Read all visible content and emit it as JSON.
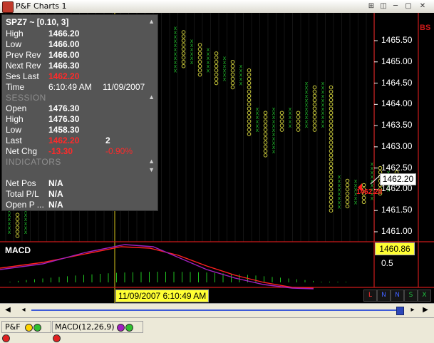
{
  "window": {
    "title": "P&F Charts 1"
  },
  "info": {
    "symbol": "SPZ7 ~ [0.10, 3]",
    "rows": [
      {
        "k": "High",
        "v": "1466.20"
      },
      {
        "k": "Low",
        "v": "1466.00"
      },
      {
        "k": "Prev Rev",
        "v": "1466.00"
      },
      {
        "k": "Next Rev",
        "v": "1466.30"
      },
      {
        "k": "Ses Last",
        "v": "1462.20"
      }
    ],
    "time_label": "Time",
    "time": "6:10:49 AM",
    "date": "11/09/2007",
    "session_header": "SESSION",
    "session": [
      {
        "k": "Open",
        "v": "1476.30"
      },
      {
        "k": "High",
        "v": "1476.30"
      },
      {
        "k": "Low",
        "v": "1458.30"
      }
    ],
    "last_label": "Last",
    "last": "1462.20",
    "last_count": "2",
    "netchg_label": "Net Chg",
    "netchg": "-13.30",
    "netchg_pct": "-0.90%",
    "indicators_header": "INDICATORS",
    "account": [
      {
        "k": "Net Pos",
        "v": "N/A"
      },
      {
        "k": "Total P/L",
        "v": "N/A"
      },
      {
        "k": "Open P ...",
        "v": "N/A"
      }
    ]
  },
  "price_axis": {
    "ticks": [
      "1465.50",
      "1465.00",
      "1464.50",
      "1464.00",
      "1463.50",
      "1463.00",
      "1462.50",
      "1462.00",
      "1461.50",
      "1461.00"
    ],
    "current_price": "1462.20",
    "last_label": "1462.20",
    "bs_label": "BS"
  },
  "macd": {
    "label": "MACD",
    "value": "1460.86",
    "tick": "0.5"
  },
  "crosshair": {
    "time": "11/09/2007 6:10:49 AM"
  },
  "chart_data": {
    "type": "point-and-figure",
    "box_size": "0.10",
    "reversal": "3",
    "ylabel": "",
    "ylim": [
      1460.8,
      1465.9
    ],
    "columns": [
      {
        "kind": "X",
        "low": 1461.0,
        "high": 1461.5
      },
      {
        "kind": "O",
        "low": 1460.9,
        "high": 1461.4
      },
      {
        "kind": "X",
        "low": 1461.0,
        "high": 1461.6
      },
      {
        "kind": "X",
        "low": 1464.8,
        "high": 1465.8
      },
      {
        "kind": "O",
        "low": 1464.9,
        "high": 1465.7
      },
      {
        "kind": "X",
        "low": 1465.0,
        "high": 1465.5
      },
      {
        "kind": "O",
        "low": 1464.7,
        "high": 1465.4
      },
      {
        "kind": "X",
        "low": 1464.8,
        "high": 1465.3
      },
      {
        "kind": "O",
        "low": 1464.5,
        "high": 1465.2
      },
      {
        "kind": "X",
        "low": 1464.6,
        "high": 1465.1
      },
      {
        "kind": "O",
        "low": 1464.4,
        "high": 1465.0
      },
      {
        "kind": "X",
        "low": 1464.5,
        "high": 1464.9
      },
      {
        "kind": "O",
        "low": 1463.3,
        "high": 1464.8
      },
      {
        "kind": "X",
        "low": 1463.4,
        "high": 1463.9
      },
      {
        "kind": "O",
        "low": 1462.8,
        "high": 1463.8
      },
      {
        "kind": "X",
        "low": 1462.9,
        "high": 1463.9
      },
      {
        "kind": "O",
        "low": 1463.4,
        "high": 1463.8
      },
      {
        "kind": "X",
        "low": 1463.5,
        "high": 1463.9
      },
      {
        "kind": "O",
        "low": 1463.4,
        "high": 1463.8
      },
      {
        "kind": "X",
        "low": 1463.5,
        "high": 1464.5
      },
      {
        "kind": "O",
        "low": 1463.4,
        "high": 1464.4
      },
      {
        "kind": "X",
        "low": 1463.5,
        "high": 1464.5
      },
      {
        "kind": "O",
        "low": 1461.5,
        "high": 1464.4
      },
      {
        "kind": "X",
        "low": 1461.6,
        "high": 1462.3
      },
      {
        "kind": "O",
        "low": 1461.6,
        "high": 1462.2
      },
      {
        "kind": "X",
        "low": 1461.7,
        "high": 1462.2
      },
      {
        "kind": "O",
        "low": 1461.7,
        "high": 1462.1
      },
      {
        "kind": "X",
        "low": 1461.8,
        "high": 1462.6
      },
      {
        "kind": "O",
        "low": 1461.9,
        "high": 1462.5
      },
      {
        "kind": "X",
        "low": 1462.0,
        "high": 1462.4
      },
      {
        "kind": "O",
        "low": 1462.2,
        "high": 1462.4
      }
    ],
    "macd_series": [
      {
        "name": "MACD",
        "color": "#ff2020"
      },
      {
        "name": "Signal",
        "color": "#a020c0"
      }
    ]
  },
  "indicator_buttons": [
    "L",
    "N",
    "N",
    "S",
    "X"
  ],
  "status": {
    "pf_label": "P&F",
    "macd_label": "MACD(12,26,9)"
  },
  "colors": {
    "x_mark": "#1fae2a",
    "o_mark": "#c8c83a",
    "crosshair": "#d7c61c",
    "border_red": "#ff2020",
    "panel": "#555555"
  }
}
